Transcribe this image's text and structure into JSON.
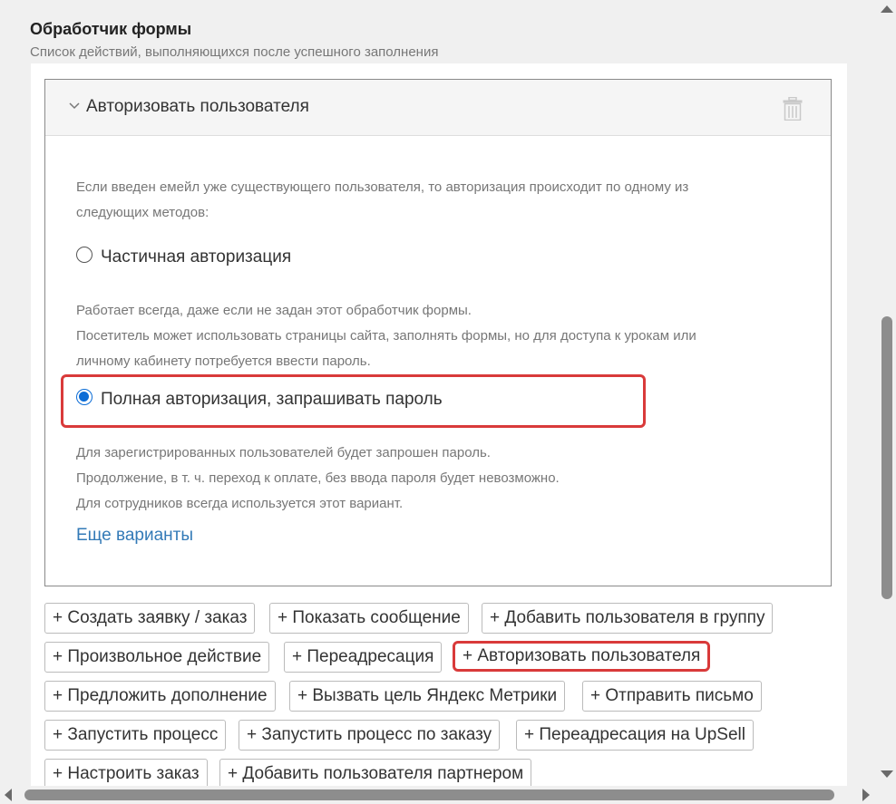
{
  "section": {
    "title": "Обработчик формы",
    "subtitle": "Список действий, выполняющихся после успешного заполнения"
  },
  "panel": {
    "title": "Авторизовать пользователя",
    "intro_line1": "Если введен емейл уже существующего пользователя, то авторизация происходит по одному из",
    "intro_line2": "следующих методов:",
    "options": [
      {
        "label": "Частичная авторизация",
        "selected": false,
        "desc": [
          "Работает всегда, даже если не задан этот обработчик формы.",
          "Посетитель может использовать страницы сайта, заполнять формы, но для доступа к урокам или",
          "личному кабинету потребуется ввести пароль."
        ]
      },
      {
        "label": "Полная авторизация, запрашивать пароль",
        "selected": true,
        "desc": [
          "Для зарегистрированных пользователей будет запрошен пароль.",
          "Продолжение, в т. ч. переход к оплате, без ввода пароля будет невозможно.",
          "Для сотрудников всегда используется этот вариант."
        ]
      }
    ],
    "more_link": "Еще варианты"
  },
  "actions": [
    "+ Создать заявку / заказ",
    "+ Показать сообщение",
    "+ Добавить пользователя в группу",
    "+ Произвольное действие",
    "+ Переадресация",
    "+ Авторизовать пользователя",
    "+ Предложить дополнение",
    "+ Вызвать цель Яндекс Метрики",
    "+ Отправить письмо",
    "+ Запустить процесс",
    "+ Запустить процесс по заказу",
    "+ Переадресация на UpSell",
    "+ Настроить заказ",
    "+ Добавить пользователя партнером"
  ],
  "colors": {
    "accent": "#0b6cd6",
    "highlight": "#d93a3a",
    "link": "#337ab7"
  }
}
